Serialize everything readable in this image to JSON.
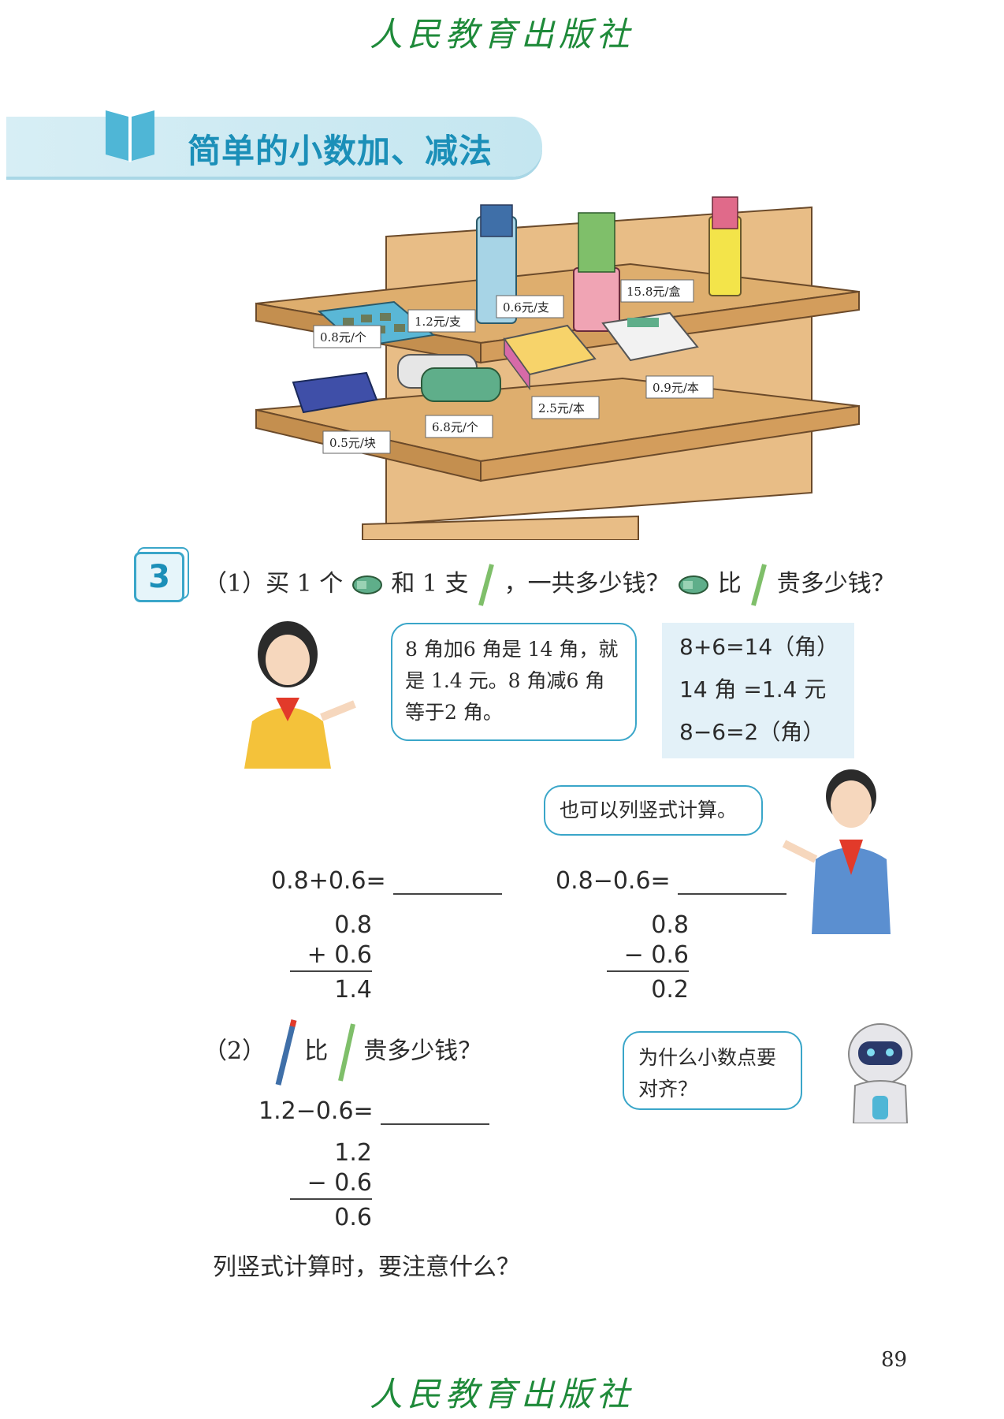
{
  "header": {
    "publisher": "人民教育出版社"
  },
  "section_title": "简单的小数加、减法",
  "prices": {
    "p1": "0.8元/个",
    "p2": "1.2元/支",
    "p3": "0.6元/支",
    "p4": "15.8元/盒",
    "p5": "0.5元/块",
    "p6": "6.8元/个",
    "p7": "2.5元/本",
    "p8": "0.9元/本"
  },
  "q3": {
    "number": "3",
    "part1_a": "（1）买 1 个",
    "part1_b": "和 1 支",
    "part1_c": "，一共多少钱？",
    "part1_d": "比",
    "part1_e": "贵多少钱？",
    "girl_bubble": "8 角加6 角是 14 角，就是 1.4 元。8 角减6 角等于2 角。",
    "calc_lines": [
      "8+6=14（角）",
      "14 角 =1.4 元",
      "8−6=2（角）"
    ],
    "boy_bubble": "也可以列竖式计算。",
    "eq1": "0.8+0.6=",
    "eq2": "0.8−0.6=",
    "v1": {
      "top": "0.8",
      "mid": "+ 0.6",
      "res": "1.4"
    },
    "v2": {
      "top": "0.8",
      "mid": "− 0.6",
      "res": "0.2"
    },
    "part2_a": "（2）",
    "part2_b": "比",
    "part2_c": "贵多少钱？",
    "eq3": "1.2−0.6=",
    "v3": {
      "top": "1.2",
      "mid": "− 0.6",
      "res": "0.6"
    },
    "robot_bubble": "为什么小数点要对齐？",
    "closing": "列竖式计算时，要注意什么？"
  },
  "footer": {
    "page_number": "89",
    "publisher": "人民教育出版社"
  },
  "colors": {
    "accent": "#1b8fb8",
    "publisher_green": "#1f8a3a",
    "shelf": "#d9a86a"
  }
}
